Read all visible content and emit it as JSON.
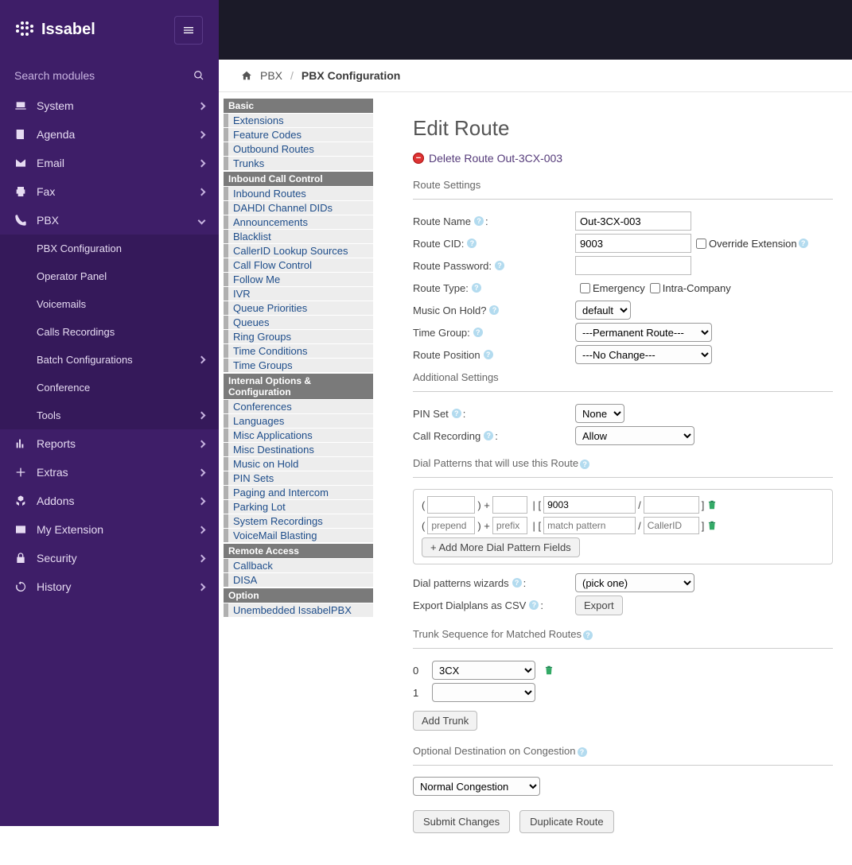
{
  "brand": "Issabel",
  "search_placeholder": "Search modules",
  "sidebar": {
    "items": [
      {
        "label": "System",
        "icon": "laptop"
      },
      {
        "label": "Agenda",
        "icon": "book"
      },
      {
        "label": "Email",
        "icon": "envelope"
      },
      {
        "label": "Fax",
        "icon": "printer"
      },
      {
        "label": "PBX",
        "icon": "phone",
        "expanded": true,
        "children": [
          {
            "label": "PBX Configuration"
          },
          {
            "label": "Operator Panel"
          },
          {
            "label": "Voicemails"
          },
          {
            "label": "Calls Recordings"
          },
          {
            "label": "Batch Configurations",
            "has_children": true
          },
          {
            "label": "Conference"
          },
          {
            "label": "Tools",
            "has_children": true
          }
        ]
      },
      {
        "label": "Reports",
        "icon": "chart"
      },
      {
        "label": "Extras",
        "icon": "plus"
      },
      {
        "label": "Addons",
        "icon": "cubes"
      },
      {
        "label": "My Extension",
        "icon": "id"
      },
      {
        "label": "Security",
        "icon": "lock"
      },
      {
        "label": "History",
        "icon": "history"
      }
    ]
  },
  "breadcrumb": {
    "root": "PBX",
    "current": "PBX Configuration"
  },
  "module_nav": [
    {
      "group": "Basic",
      "items": [
        "Extensions",
        "Feature Codes",
        "Outbound Routes",
        "Trunks"
      ]
    },
    {
      "group": "Inbound Call Control",
      "items": [
        "Inbound Routes",
        "DAHDI Channel DIDs",
        "Announcements",
        "Blacklist",
        "CallerID Lookup Sources",
        "Call Flow Control",
        "Follow Me",
        "IVR",
        "Queue Priorities",
        "Queues",
        "Ring Groups",
        "Time Conditions",
        "Time Groups"
      ]
    },
    {
      "group": "Internal Options & Configuration",
      "items": [
        "Conferences",
        "Languages",
        "Misc Applications",
        "Misc Destinations",
        "Music on Hold",
        "PIN Sets",
        "Paging and Intercom",
        "Parking Lot",
        "System Recordings",
        "VoiceMail Blasting"
      ]
    },
    {
      "group": "Remote Access",
      "items": [
        "Callback",
        "DISA"
      ]
    },
    {
      "group": "Option",
      "items": [
        "Unembedded IssabelPBX"
      ]
    }
  ],
  "form": {
    "title": "Edit Route",
    "delete_label": "Delete Route Out-3CX-003",
    "section_settings": "Route Settings",
    "route_name_label": "Route Name",
    "route_name": "Out-3CX-003",
    "route_cid_label": "Route CID:",
    "route_cid": "9003",
    "override_ext_label": "Override Extension",
    "route_password_label": "Route Password:",
    "route_password": "",
    "route_type_label": "Route Type:",
    "emergency_label": "Emergency",
    "intra_label": "Intra-Company",
    "moh_label": "Music On Hold?",
    "moh_value": "default",
    "time_group_label": "Time Group:",
    "time_group_value": "---Permanent Route---",
    "route_position_label": "Route Position",
    "route_position_value": "---No Change---",
    "section_additional": "Additional Settings",
    "pinset_label": "PIN Set",
    "pinset_value": "None",
    "call_recording_label": "Call Recording",
    "call_recording_value": "Allow",
    "dial_patterns_label": "Dial Patterns that will use this Route",
    "pattern1": {
      "prepend": "",
      "prefix": "",
      "match": "9003",
      "cid": ""
    },
    "pattern2_placeholders": {
      "prepend": "prepend",
      "prefix": "prefix",
      "match": "match pattern",
      "cid": "CallerID"
    },
    "add_more_label": "+ Add More Dial Pattern Fields",
    "wizards_label": "Dial patterns wizards",
    "wizards_value": "(pick one)",
    "export_label": "Export Dialplans as CSV",
    "export_btn": "Export",
    "trunk_seq_label": "Trunk Sequence for Matched Routes",
    "trunks": [
      {
        "idx": "0",
        "value": "3CX"
      },
      {
        "idx": "1",
        "value": ""
      }
    ],
    "add_trunk_label": "Add Trunk",
    "congestion_label": "Optional Destination on Congestion",
    "congestion_value": "Normal Congestion",
    "submit_label": "Submit Changes",
    "duplicate_label": "Duplicate Route"
  }
}
